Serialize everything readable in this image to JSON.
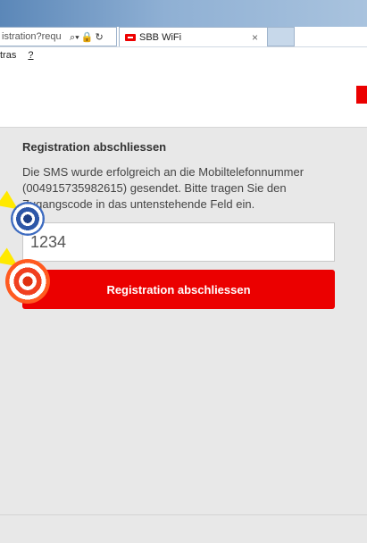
{
  "browser": {
    "url_fragment": "istration?requ",
    "search_icon": "search-icon",
    "lock_icon": "lock-icon",
    "refresh_icon": "refresh-icon",
    "tab_title": "SBB WiFi",
    "tab_close": "×",
    "menu": [
      "tras",
      "?"
    ]
  },
  "brand": {
    "accent": "#eb0000"
  },
  "form": {
    "heading": "Registration abschliessen",
    "description": "Die SMS wurde erfolgreich an die Mobiltelefonnummer (004915735982615) gesendet. Bitte tragen Sie den Zugangscode in das untenstehende Feld ein.",
    "code_value": "1234",
    "submit_label": "Registration abschliessen"
  },
  "markers": [
    {
      "name": "step-marker-blue",
      "color": "#2d57a8"
    },
    {
      "name": "step-marker-red",
      "color": "#f04020"
    }
  ]
}
